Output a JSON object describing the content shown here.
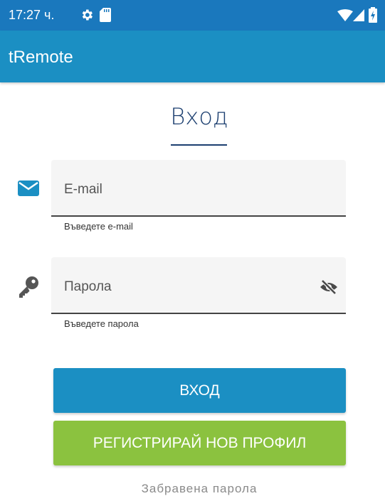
{
  "status_bar": {
    "time": "17:27 ч.",
    "icons": [
      "settings-icon",
      "sd-card-icon",
      "wifi-icon",
      "signal-icon",
      "battery-icon"
    ]
  },
  "app_bar": {
    "title": "tRemote"
  },
  "login": {
    "title": "Вход",
    "email": {
      "placeholder": "E-mail",
      "helper": "Въведете e-mail",
      "icon": "mail-icon"
    },
    "password": {
      "placeholder": "Парола",
      "helper": "Въведете парола",
      "icon": "key-icon",
      "toggle_icon": "eye-off-icon"
    },
    "login_button": "ВХОД",
    "register_button": "РЕГИСТРИРАЙ НОВ ПРОФИЛ",
    "forgot_password": "Забравена парола"
  },
  "colors": {
    "status_bar": "#1a78bd",
    "app_bar": "#1b8fc3",
    "title": "#1c3f70",
    "primary_button": "#1b8fc3",
    "secondary_button": "#8bc23f"
  }
}
